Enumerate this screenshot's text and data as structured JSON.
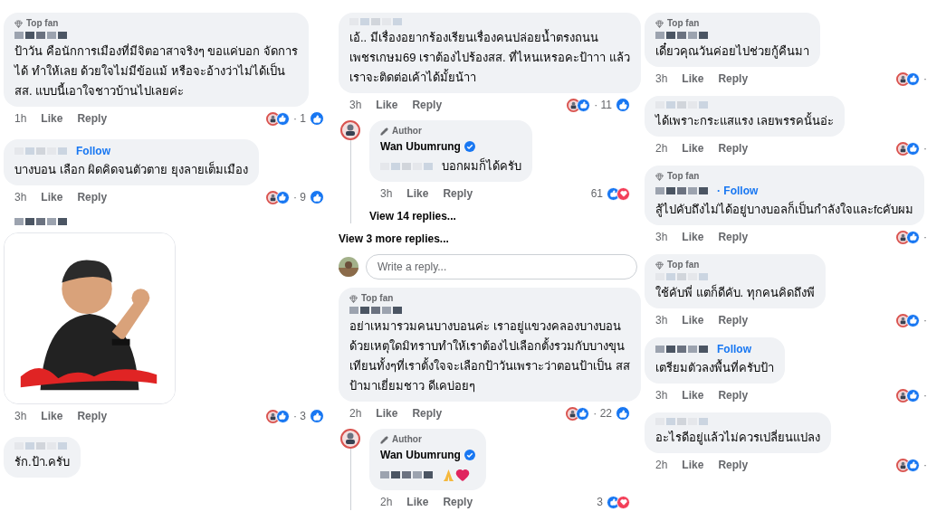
{
  "columns": [
    {
      "items": [
        {
          "kind": "comment",
          "top_fan": "Top fan",
          "lines": [
            "ป้าวัน คือนักการเมืองที่มีจิตอาสาจริงๆ ขอแค่บอก จัดการ",
            "ได้ ทำให้เลย ด้วยใจไม่มีข้อแม้ หรือจะอ้างว่าไม่ได้เป็น",
            "สส. แบบนี้เอาใจชาวบ้านไปเลยค่ะ"
          ],
          "time": "1h",
          "like": "Like",
          "reply": "Reply",
          "reactions": {
            "kind": "leading",
            "count": "· 1"
          }
        },
        {
          "kind": "comment",
          "follow": "Follow",
          "lines": [
            "บางบอน เลือก ผิดคิดจนตัวตาย ยุงลายเต็มเมือง"
          ],
          "time": "3h",
          "like": "Like",
          "reply": "Reply",
          "reactions": {
            "kind": "leading",
            "count": "· 9"
          }
        },
        {
          "kind": "sticker",
          "time": "3h",
          "like": "Like",
          "reply": "Reply",
          "reactions": {
            "kind": "leading",
            "count": "· 3"
          }
        },
        {
          "kind": "comment",
          "lines": [
            "รัก.ป้า.ครับ"
          ]
        }
      ]
    },
    {
      "items": [
        {
          "kind": "comment",
          "lines": [
            "เอ้.. มีเรื่องอยากร้องเรียนเรื่องคนปล่อยน้ำตรงถนน",
            "เพชรเกษม69 เราต้องไปร้องสส. ที่ไหนเหรอคะป้าาา แล้ว",
            "เราจะติดต่อเค้าได้มั้ยน้าา"
          ],
          "time": "3h",
          "like": "Like",
          "reply": "Reply",
          "reactions": {
            "kind": "leading",
            "count": "· 11"
          },
          "replies": [
            {
              "kind": "comment",
              "author": "Author",
              "name": "Wan Ubumrung",
              "verified": true,
              "blur_prefix": true,
              "lines": [
                "บอกผมก็ได้ครับ"
              ],
              "time": "3h",
              "like": "Like",
              "reply": "Reply",
              "reactions": {
                "kind": "trailing",
                "count": "61"
              }
            }
          ],
          "view_replies": "View 14 replies..."
        },
        {
          "kind": "more",
          "label": "View 3 more replies..."
        },
        {
          "kind": "write",
          "placeholder": "Write a reply..."
        },
        {
          "kind": "comment",
          "top_fan": "Top fan",
          "lines": [
            "อย่าเหมารวมคนบางบอนค่ะ เราอยู่แขวงคลองบางบอน",
            "ด้วยเหตุใดมิทราบทำให้เราต้องไปเลือกตั้งรวมกับบางขุน",
            "เทียนทั้งๆที่เราตั้งใจจะเลือกป้าวันเพราะว่าตอนป้าเป็น สส",
            "ป้ามาเยี่ยมชาว ดีเคบ่อยๆ"
          ],
          "time": "2h",
          "like": "Like",
          "reply": "Reply",
          "reactions": {
            "kind": "leading",
            "count": "· 22"
          },
          "replies": [
            {
              "kind": "comment",
              "author": "Author",
              "name": "Wan Ubumrung",
              "verified": true,
              "blur_prefix": true,
              "emoji": [
                {
                  "kind": "pray"
                },
                {
                  "kind": "heart"
                }
              ],
              "time": "2h",
              "like": "Like",
              "reply": "Reply",
              "reactions": {
                "kind": "trailing",
                "count": "3"
              }
            }
          ]
        }
      ]
    },
    {
      "items": [
        {
          "kind": "comment",
          "top_fan": "Top fan",
          "lines": [
            "เดี๋ยวคุณวันค่อยไปช่วยกู้คืนมา"
          ],
          "time": "3h",
          "like": "Like",
          "reply": "Reply",
          "reactions": {
            "kind": "clipped",
            "count": "·"
          }
        },
        {
          "kind": "comment",
          "lines": [
            "ได้เพราะกระแสแรง เลยพรรคนั้นอ่ะ"
          ],
          "time": "2h",
          "like": "Like",
          "reply": "Reply",
          "reactions": {
            "kind": "clipped",
            "count": "·"
          }
        },
        {
          "kind": "comment",
          "top_fan": "Top fan",
          "follow": "· Follow",
          "lines": [
            "สู้ไปคับถึงไม่ได้อยู่บางบอลก็เป็นกำลังใจและfcคับผม"
          ],
          "time": "3h",
          "like": "Like",
          "reply": "Reply",
          "reactions": {
            "kind": "clipped",
            "count": "·"
          }
        },
        {
          "kind": "comment",
          "top_fan": "Top fan",
          "lines": [
            "ใช้คับพี่  แตก็ดีคับ. ทุกคนคิดถึงพี"
          ],
          "time": "3h",
          "like": "Like",
          "reply": "Reply",
          "reactions": {
            "kind": "clipped",
            "count": "·"
          }
        },
        {
          "kind": "comment",
          "follow": "Follow",
          "lines": [
            "เตรียมตัวลงพื้นที่ครับป้า"
          ],
          "time": "3h",
          "like": "Like",
          "reply": "Reply",
          "reactions": {
            "kind": "clipped",
            "count": "·"
          }
        },
        {
          "kind": "comment",
          "lines": [
            "อะไรดีอยู่แล้วไม่ควรเปลี่ยนแปลง"
          ],
          "time": "2h",
          "like": "Like",
          "reply": "Reply",
          "reactions": {
            "kind": "clipped",
            "count": "·"
          }
        }
      ]
    }
  ]
}
